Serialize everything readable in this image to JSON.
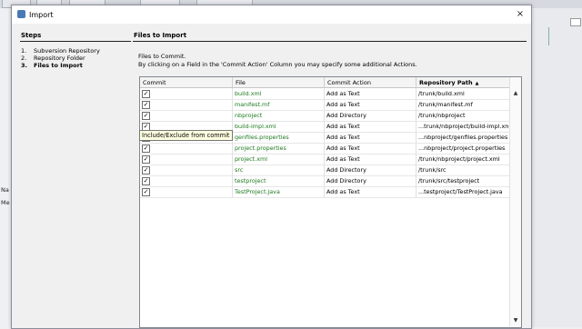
{
  "dialog": {
    "title": "Import",
    "close_symbol": "×",
    "icon": "netbeans-app-icon"
  },
  "steps": {
    "title": "Steps",
    "items": [
      {
        "num": "1.",
        "label": "Subversion Repository",
        "active": false
      },
      {
        "num": "2.",
        "label": "Repository Folder",
        "active": false
      },
      {
        "num": "3.",
        "label": "Files to Import",
        "active": true
      }
    ]
  },
  "main": {
    "title": "Files to Import",
    "intro_line1": "Files to Commit.",
    "intro_line2": "By clicking on a Field in the 'Commit Action' Column you may specify some additional Actions.",
    "table": {
      "columns": [
        "Commit",
        "File",
        "Commit Action",
        "Repository Path"
      ],
      "sort_indicator": "▲",
      "rows": [
        {
          "checked": true,
          "file": "build.xml",
          "action": "Add as Text",
          "path": "/trunk/build.xml"
        },
        {
          "checked": true,
          "file": "manifest.mf",
          "action": "Add as Text",
          "path": "/trunk/manifest.mf"
        },
        {
          "checked": true,
          "file": "nbproject",
          "action": "Add Directory",
          "path": "/trunk/nbproject"
        },
        {
          "checked": true,
          "file": "build-impl.xml",
          "action": "Add as Text",
          "path": "...trunk/nbproject/build-impl.xml"
        },
        {
          "checked": true,
          "file": "genfiles.properties",
          "action": "Add as Text",
          "path": "...nbproject/genfiles.properties"
        },
        {
          "checked": true,
          "file": "project.properties",
          "action": "Add as Text",
          "path": "...nbproject/project.properties"
        },
        {
          "checked": true,
          "file": "project.xml",
          "action": "Add as Text",
          "path": "/trunk/nbproject/project.xml"
        },
        {
          "checked": true,
          "file": "src",
          "action": "Add Directory",
          "path": "/trunk/src"
        },
        {
          "checked": true,
          "file": "testproject",
          "action": "Add Directory",
          "path": "/trunk/src/testproject"
        },
        {
          "checked": true,
          "file": "TestProject.java",
          "action": "Add as Text",
          "path": "...testproject/TestProject.java"
        }
      ]
    },
    "tooltip": "Include/Exclude from commit"
  },
  "background_ide": {
    "left_labels": [
      "Na",
      "Me"
    ]
  },
  "colors": {
    "file_text": "#1e7a1e",
    "tooltip_bg": "#ffffe1"
  }
}
